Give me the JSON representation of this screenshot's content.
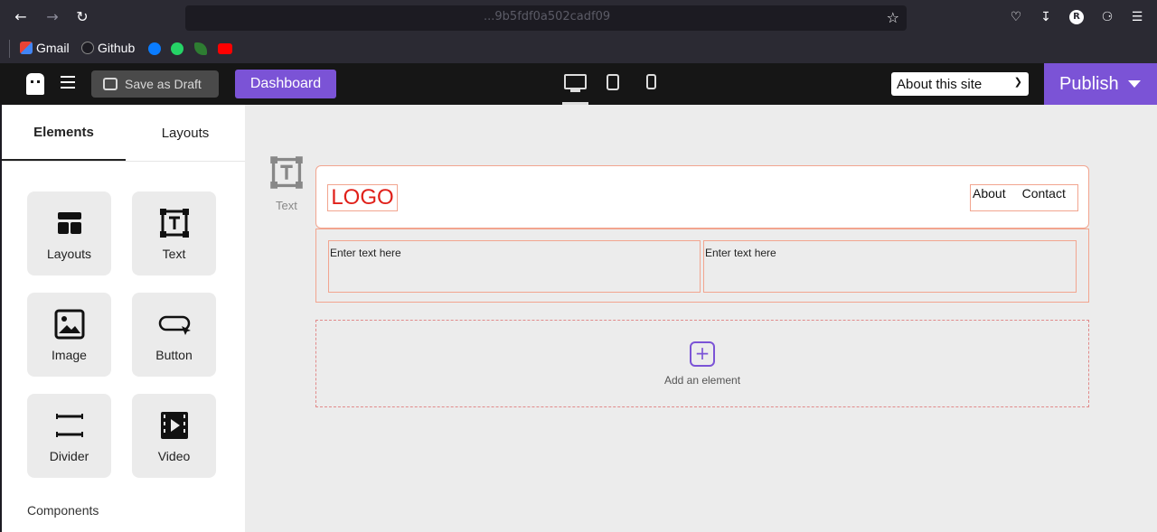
{
  "browser": {
    "url_partial": "...9b5fdf0a502cadf09",
    "bookmarks": [
      "Gmail",
      "Github"
    ],
    "colors": {
      "accent": "#7b53d6"
    }
  },
  "header": {
    "save_draft_label": "Save as Draft",
    "dashboard_label": "Dashboard",
    "site_select_value": "About this site",
    "publish_label": "Publish"
  },
  "sidebar": {
    "tabs": [
      "Elements",
      "Layouts"
    ],
    "elements": [
      "Layouts",
      "Text",
      "Image",
      "Button",
      "Divider",
      "Video"
    ],
    "components_label": "Components"
  },
  "canvas": {
    "drag_ghost_label": "Text",
    "logo_text": "LOGO",
    "nav_links": [
      "About",
      "Contact"
    ],
    "text_placeholders": [
      "Enter text here",
      "Enter text here"
    ],
    "add_element_label": "Add an element"
  }
}
